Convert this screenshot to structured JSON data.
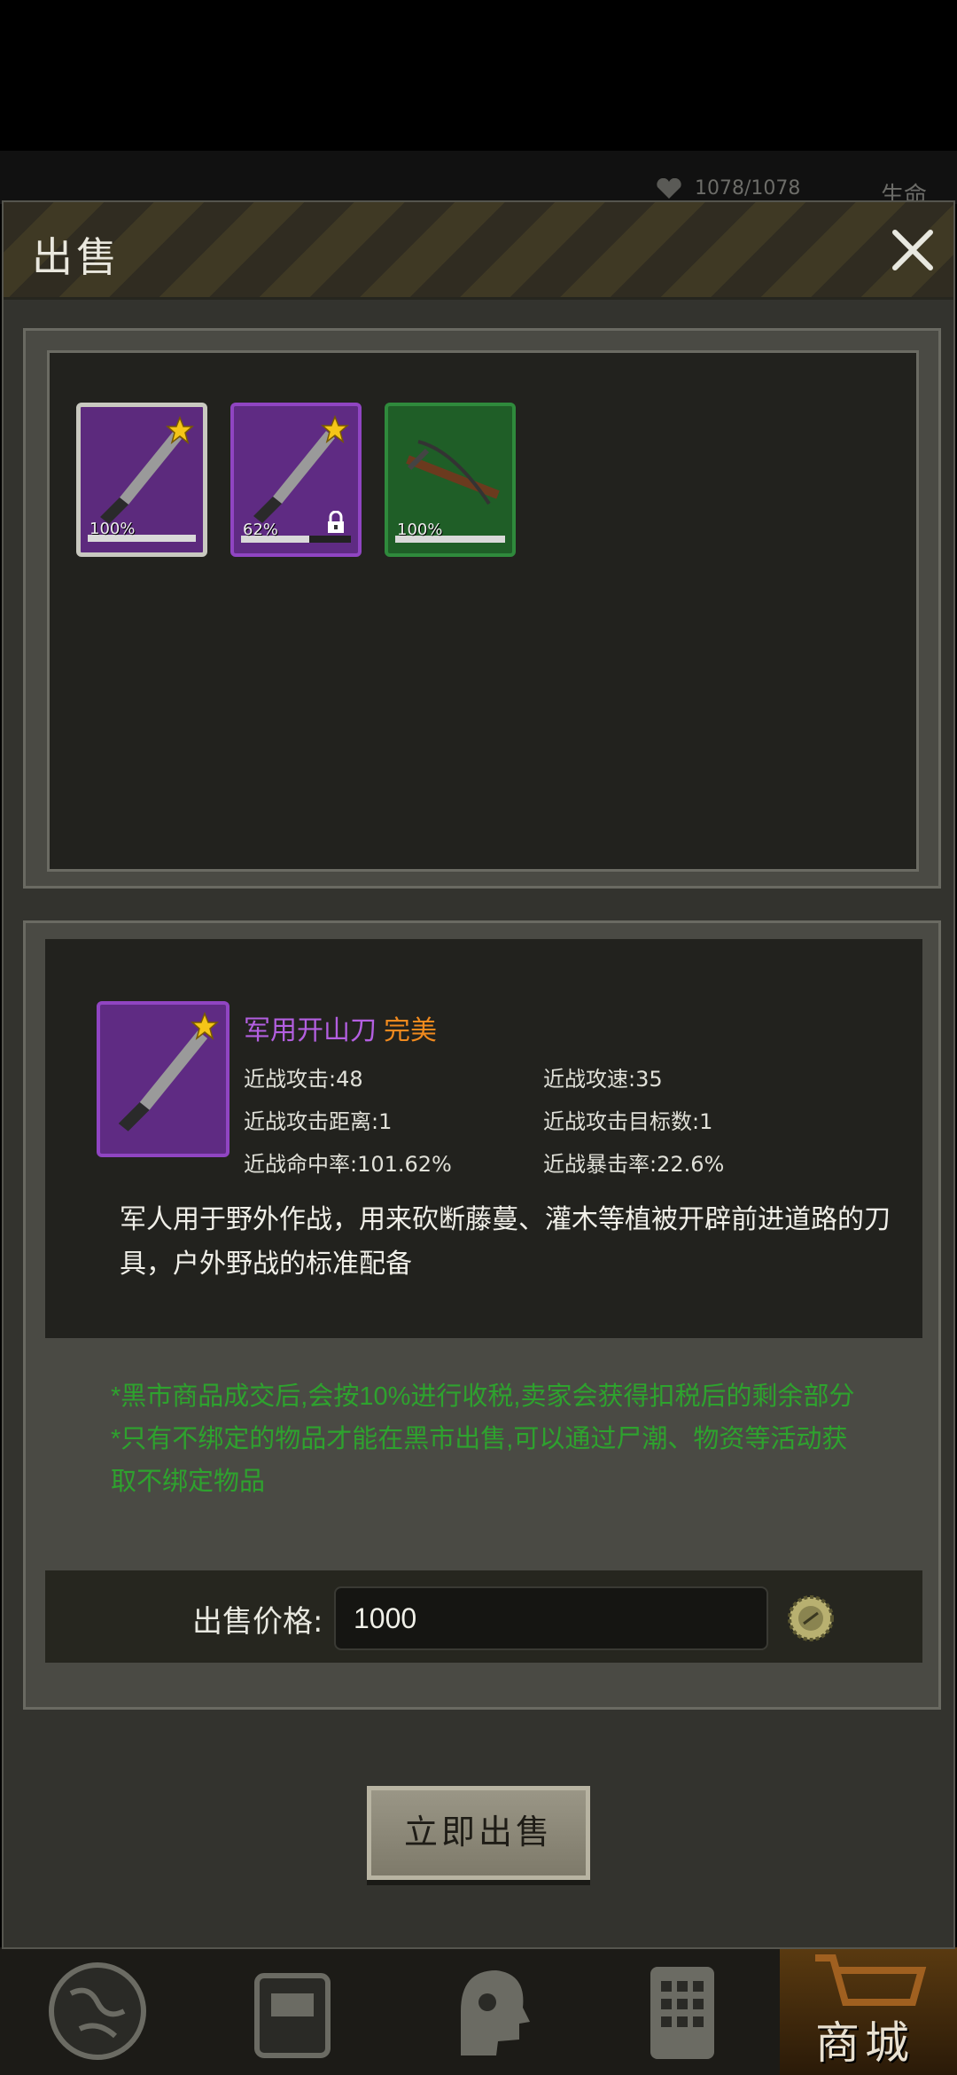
{
  "background": {
    "hp": "1078/1078",
    "life_label": "生命"
  },
  "modal": {
    "title": "出售",
    "inventory": [
      {
        "percent": "100%",
        "durability": 1.0,
        "rarity": "purple",
        "starred": true,
        "locked": false,
        "selected": true
      },
      {
        "percent": "62%",
        "durability": 0.62,
        "rarity": "purple",
        "starred": true,
        "locked": true,
        "selected": false
      },
      {
        "percent": "100%",
        "durability": 1.0,
        "rarity": "green",
        "starred": false,
        "locked": false,
        "selected": false
      }
    ],
    "detail": {
      "name": "军用开山刀",
      "quality": "完美",
      "stats": [
        "近战攻击:48",
        "近战攻速:35",
        "近战攻击距离:1",
        "近战攻击目标数:1",
        "近战命中率:101.62%",
        "近战暴击率:22.6%"
      ],
      "description": "军人用于野外作战，用来砍断藤蔓、灌木等植被开辟前进道路的刀具，户外野战的标准配备"
    },
    "notes": [
      "*黑市商品成交后,会按10%进行收税,卖家会获得扣税后的剩余部分",
      "*只有不绑定的物品才能在黑市出售,可以通过尸潮、物资等活动获取不绑定物品"
    ],
    "price_label": "出售价格:",
    "price_value": "1000",
    "sell_button": "立即出售"
  },
  "bottom_nav": {
    "items": [
      "globe-icon",
      "backpack-icon",
      "head-icon",
      "phone-icon",
      "shop-cart-icon"
    ],
    "shop_label": "商城"
  },
  "colors": {
    "rarity_purple": "#5f2b83",
    "rarity_green": "#1f5e27",
    "item_name": "#b35fe0",
    "quality": "#f08a1e",
    "note_text": "#2ea22e"
  }
}
